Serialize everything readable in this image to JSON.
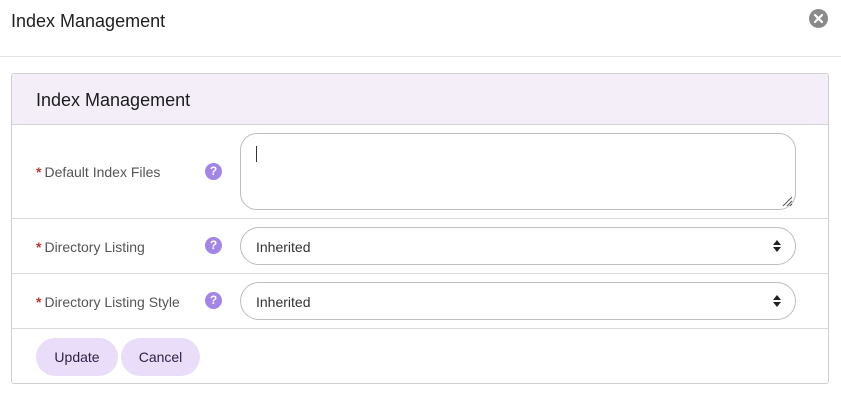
{
  "modal": {
    "title": "Index Management"
  },
  "card": {
    "title": "Index Management"
  },
  "fields": {
    "default_index_files": {
      "required_mark": "*",
      "label": "Default Index Files",
      "help": "?",
      "value": ""
    },
    "directory_listing": {
      "required_mark": "*",
      "label": "Directory Listing",
      "help": "?",
      "value": "Inherited"
    },
    "directory_listing_style": {
      "required_mark": "*",
      "label": "Directory Listing Style",
      "help": "?",
      "value": "Inherited"
    }
  },
  "actions": {
    "update_label": "Update",
    "cancel_label": "Cancel"
  },
  "icons": {
    "close": "close-icon",
    "help": "help-icon",
    "select_arrow": "sort-arrows-icon"
  },
  "colors": {
    "card_header_bg": "#f3eef8",
    "help_icon": "#a385e8",
    "button_bg": "#e9ddfa",
    "required": "#c0392b"
  }
}
